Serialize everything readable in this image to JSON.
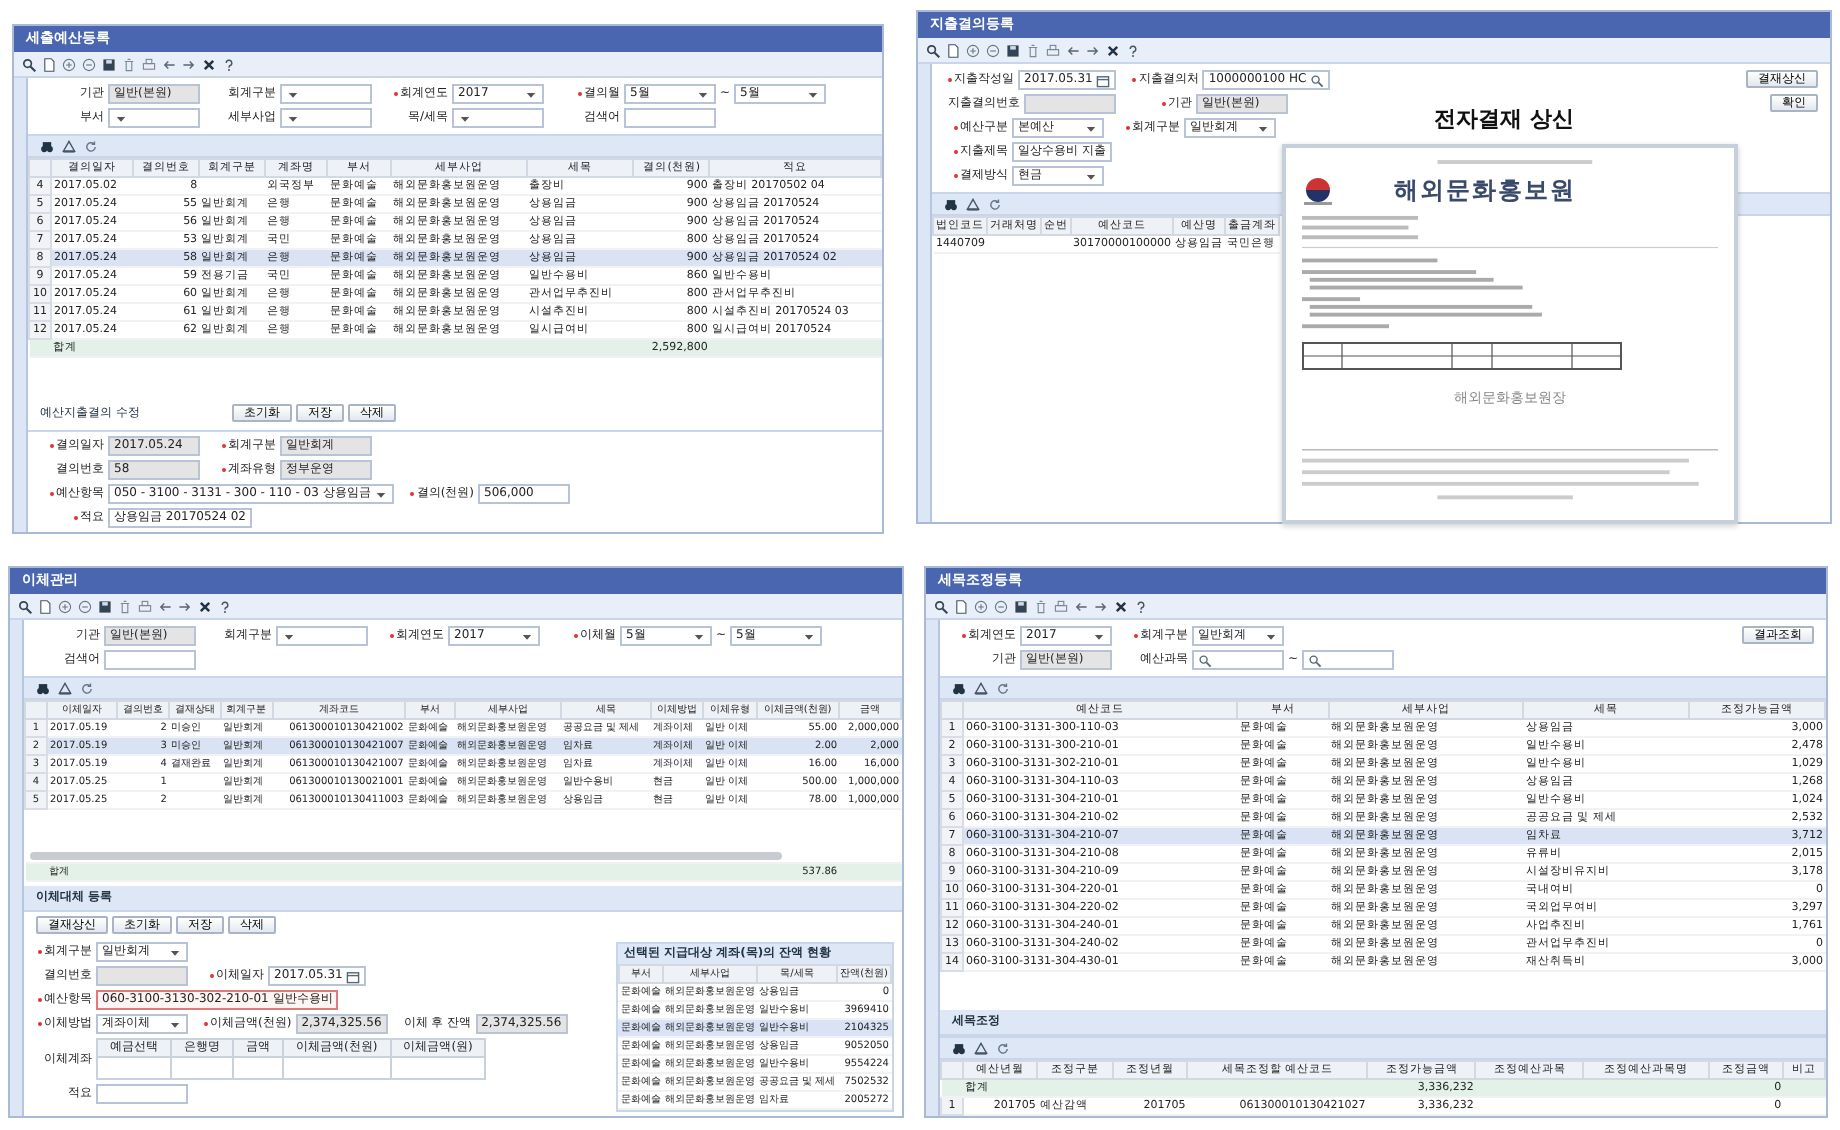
{
  "windows": [
    {
      "title": "세출예산등록",
      "form": {
        "rows": [
          [
            {
              "label": "기관",
              "value": "일반(본원)",
              "kind": "readonly",
              "required": false
            },
            {
              "label": "회계구분",
              "kind": "select",
              "required": false
            },
            {
              "label": "회계연도",
              "value": "2017",
              "kind": "select",
              "required": true
            },
            {
              "label": "결의월",
              "value": "5월",
              "kind": "select",
              "required": true,
              "separator": "~",
              "to": "5월"
            }
          ],
          [
            {
              "label": "부서",
              "kind": "select",
              "required": false
            },
            {
              "label": "세부사업",
              "kind": "select",
              "required": false
            },
            {
              "label": "목/세목",
              "kind": "select",
              "required": false
            },
            {
              "label": "검색어",
              "kind": "text",
              "required": false
            }
          ]
        ]
      },
      "grid": {
        "columns": [
          "결의일자",
          "결의번호",
          "회계구분",
          "계좌명",
          "부서",
          "세부사업",
          "세목",
          "결의(천원)",
          "적요"
        ],
        "rows": [
          {
            "no": "4",
            "cells": [
              "2017.05.02",
              "8",
              null,
              "외국정부",
              "문화예술",
              "해외문화홍보원운영",
              "출장비",
              "900",
              "출장비 20170502 04"
            ],
            "selected": false
          },
          {
            "no": "5",
            "cells": [
              "2017.05.24",
              "55",
              "일반회계",
              "은행",
              "문화예술",
              "해외문화홍보원운영",
              "상용임금",
              "900",
              "상용임금 20170524"
            ],
            "selected": false
          },
          {
            "no": "6",
            "cells": [
              "2017.05.24",
              "56",
              "일반회계",
              "은행",
              "문화예술",
              "해외문화홍보원운영",
              "상용임금",
              "900",
              "상용임금 20170524"
            ],
            "selected": false
          },
          {
            "no": "7",
            "cells": [
              "2017.05.24",
              "53",
              "일반회계",
              "국민",
              "문화예술",
              "해외문화홍보원운영",
              "상용임금",
              "800",
              "상용임금 20170524"
            ],
            "selected": false
          },
          {
            "no": "8",
            "cells": [
              "2017.05.24",
              "58",
              "일반회계",
              "은행",
              "문화예술",
              "해외문화홍보원운영",
              "상용임금",
              "900",
              "상용임금 20170524 02"
            ],
            "selected": true
          },
          {
            "no": "9",
            "cells": [
              "2017.05.24",
              "59",
              "전용기금",
              "국민",
              "문화예술",
              "해외문화홍보원운영",
              "일반수용비",
              "860",
              "일반수용비"
            ],
            "selected": false
          },
          {
            "no": "10",
            "cells": [
              "2017.05.24",
              "60",
              "일반회계",
              "은행",
              "문화예술",
              "해외문화홍보원운영",
              "관서업무추진비",
              "800",
              "관서업무추진비"
            ],
            "selected": false
          },
          {
            "no": "11",
            "cells": [
              "2017.05.24",
              "61",
              "일반회계",
              "은행",
              "문화예술",
              "해외문화홍보원운영",
              "시설추진비",
              "800",
              "시설추진비 20170524 03"
            ],
            "selected": false
          },
          {
            "no": "12",
            "cells": [
              "2017.05.24",
              "62",
              "일반회계",
              "은행",
              "문화예술",
              "해외문화홍보원운영",
              "일시급여비",
              "800",
              "일시급여비 20170524"
            ],
            "selected": false
          }
        ],
        "total": {
          "cells": [
            "합계",
            null,
            null,
            null,
            null,
            null,
            null,
            "2,592,800",
            null
          ]
        }
      },
      "section": {
        "title": "예산지출결의 수정",
        "buttons": [
          "초기화",
          "저장",
          "삭제"
        ],
        "form": {
          "rows": [
            [
              {
                "label": "결의일자",
                "value": "2017.05.24",
                "kind": "readonly",
                "required": true
              },
              {
                "label": "회계구분",
                "value": "일반회계",
                "kind": "readonly",
                "required": true
              }
            ],
            [
              {
                "label": "결의번호",
                "value": "58",
                "kind": "readonly",
                "required": false
              },
              {
                "label": "계좌유형",
                "value": "정부운영",
                "kind": "readonly",
                "required": true
              }
            ],
            [
              {
                "label": "예산항목",
                "value": "050 - 3100 - 3131 - 300 - 110 - 03 상용임금",
                "kind": "select",
                "required": true
              },
              {
                "label": "결의(천원)",
                "value": "506,000",
                "kind": "text",
                "required": true
              }
            ],
            [
              {
                "label": "적요",
                "value": "상용임금 20170524 02",
                "kind": "text",
                "required": true
              }
            ]
          ]
        }
      }
    },
    {
      "title": "지출결의등록",
      "form": {
        "rows": [
          [
            {
              "label": "지출작성일",
              "value": "2017.05.31",
              "kind": "date",
              "required": true
            },
            {
              "label": "지출결의처",
              "value": "1000000100 HC",
              "kind": "lookup",
              "required": true
            }
          ],
          [
            {
              "label": "지출결의번호",
              "kind": "readonly",
              "required": false
            },
            {
              "label": "기관",
              "value": "일반(본원)",
              "kind": "readonly",
              "required": true
            }
          ],
          [
            {
              "label": "예산구분",
              "value": "본예산",
              "kind": "select",
              "required": true
            },
            {
              "label": "회계구분",
              "value": "일반회계",
              "kind": "select",
              "required": true
            }
          ],
          [
            {
              "label": "지출제목",
              "value": "일상수용비 지출",
              "kind": "text",
              "required": true
            }
          ],
          [
            {
              "label": "결제방식",
              "value": "현금",
              "kind": "select",
              "required": true
            }
          ]
        ]
      },
      "side_buttons": [
        "결재상신",
        "확인"
      ],
      "grid": {
        "columns": [
          "법인코드",
          "거래처명",
          "순번",
          "예산코드",
          "예산명",
          "출금계좌"
        ],
        "rows": [
          {
            "cells": [
              "1440709",
              null,
              null,
              "30170000100000",
              "상용임금",
              "국민은행"
            ],
            "selected": false
          }
        ]
      },
      "overlay": {
        "heading": "전자결재 상신",
        "document": {
          "title": "해외문화홍보원",
          "footer": "해외문화홍보원장"
        }
      }
    },
    {
      "title": "이체관리",
      "form": {
        "rows": [
          [
            {
              "label": "기관",
              "value": "일반(본원)",
              "kind": "readonly",
              "required": false
            },
            {
              "label": "회계구분",
              "kind": "select",
              "required": false
            },
            {
              "label": "회계연도",
              "value": "2017",
              "kind": "select",
              "required": true
            },
            {
              "label": "이체월",
              "value": "5월",
              "kind": "select",
              "required": true,
              "separator": "~",
              "to": "5월"
            }
          ],
          [
            {
              "label": "검색어",
              "kind": "text",
              "required": false
            }
          ]
        ]
      },
      "grid": {
        "columns": [
          "이체일자",
          "결의번호",
          "결재상태",
          "회계구분",
          "계좌코드",
          "부서",
          "세부사업",
          "세목",
          "이체방법",
          "이체유형",
          "이체금액(천원)",
          "금액"
        ],
        "rows": [
          {
            "no": "1",
            "cells": [
              "2017.05.19",
              "2",
              "미승인",
              "일반회계",
              "061300010130421002",
              "문화예술",
              "해외문화홍보원운영",
              "공공요금 및 제세",
              "계좌이체",
              "일반 이체",
              "55.00",
              "2,000,000"
            ],
            "selected": false
          },
          {
            "no": "2",
            "cells": [
              "2017.05.19",
              "3",
              "미승인",
              "일반회계",
              "061300010130421007",
              "문화예술",
              "해외문화홍보원운영",
              "임차료",
              "계좌이체",
              "일반 이체",
              "2.00",
              "2,000"
            ],
            "selected": true
          },
          {
            "no": "3",
            "cells": [
              "2017.05.19",
              "4",
              "결재완료",
              "일반회계",
              "061300010130421007",
              "문화예술",
              "해외문화홍보원운영",
              "임차료",
              "계좌이체",
              "일반 이체",
              "16.00",
              "16,000"
            ],
            "selected": false
          },
          {
            "no": "4",
            "cells": [
              "2017.05.25",
              "1",
              null,
              "일반회계",
              "061300010130021001",
              "문화예술",
              "해외문화홍보원운영",
              "일반수용비",
              "현금",
              "일반 이체",
              "500.00",
              "1,000,000"
            ],
            "selected": false
          },
          {
            "no": "5",
            "cells": [
              "2017.05.25",
              "2",
              null,
              "일반회계",
              "061300010130411003",
              "문화예술",
              "해외문화홍보원운영",
              "상용임금",
              "현금",
              "일반 이체",
              "78.00",
              "1,000,000"
            ],
            "selected": false
          }
        ],
        "total": {
          "cells": [
            "합계",
            null,
            null,
            null,
            null,
            null,
            null,
            null,
            null,
            null,
            "537.86",
            null
          ]
        }
      },
      "section": {
        "title": "이체대체 등록",
        "buttons": [
          "결재상신",
          "초기화",
          "저장",
          "삭제"
        ],
        "form": {
          "rows": [
            [
              {
                "label": "회계구분",
                "value": "일반회계",
                "kind": "select",
                "required": true
              }
            ],
            [
              {
                "label": "결의번호",
                "kind": "readonly",
                "required": false
              },
              {
                "label": "이체일자",
                "value": "2017.05.31",
                "kind": "date",
                "required": true
              }
            ],
            [
              {
                "label": "예산항목",
                "value": "060-3100-3130-302-210-01 일반수용비",
                "kind": "text",
                "required": true,
                "invalid": true
              }
            ],
            [
              {
                "label": "이체방법",
                "value": "계좌이체",
                "kind": "select",
                "required": true
              },
              {
                "label": "이체금액(천원)",
                "value": "2,374,325.56",
                "kind": "readonly",
                "required": true
              },
              {
                "label": "이체 후 잔액",
                "value": "2,374,325.56",
                "kind": "readonly",
                "required": false
              }
            ],
            [
              {
                "label": "이체계좌",
                "kind": "table",
                "required": false,
                "columns": [
                  "예금선택",
                  "은행명",
                  "금액",
                  "이체금액(천원)",
                  "이체금액(원)"
                ]
              }
            ],
            [
              {
                "label": "적요",
                "kind": "text",
                "required": false
              }
            ]
          ]
        },
        "aside": {
          "title": "선택된 지급대상 계좌(목)의 잔액 현황",
          "grid": {
            "columns": [
              "부서",
              "세부사업",
              "목/세목",
              "잔액(천원)"
            ],
            "rows": [
              {
                "cells": [
                  "문화예술",
                  "해외문화홍보원운영",
                  "상용임금",
                  "0"
                ],
                "selected": false
              },
              {
                "cells": [
                  "문화예술",
                  "해외문화홍보원운영",
                  "일반수용비",
                  "3969410"
                ],
                "selected": false
              },
              {
                "cells": [
                  "문화예술",
                  "해외문화홍보원운영",
                  "일반수용비",
                  "2104325"
                ],
                "selected": true
              },
              {
                "cells": [
                  "문화예술",
                  "해외문화홍보원운영",
                  "상용임금",
                  "9052050"
                ],
                "selected": false
              },
              {
                "cells": [
                  "문화예술",
                  "해외문화홍보원운영",
                  "일반수용비",
                  "9554224"
                ],
                "selected": false
              },
              {
                "cells": [
                  "문화예술",
                  "해외문화홍보원운영",
                  "공공요금 및 제세",
                  "7502532"
                ],
                "selected": false
              },
              {
                "cells": [
                  "문화예술",
                  "해외문화홍보원운영",
                  "임차료",
                  "2005272"
                ],
                "selected": false
              }
            ]
          }
        }
      }
    },
    {
      "title": "세목조정등록",
      "form": {
        "rows": [
          [
            {
              "label": "회계연도",
              "value": "2017",
              "kind": "select",
              "required": true
            },
            {
              "label": "회계구분",
              "value": "일반회계",
              "kind": "select",
              "required": true
            }
          ],
          [
            {
              "label": "기관",
              "value": "일반(본원)",
              "kind": "readonly",
              "required": false
            },
            {
              "label": "예산과목",
              "kind": "lookup",
              "required": false,
              "separator": "~"
            }
          ]
        ]
      },
      "side_buttons": [
        "결과조회"
      ],
      "grid": {
        "columns": [
          "예산코드",
          "부서",
          "세부사업",
          "세목",
          "조정가능금액"
        ],
        "rows": [
          {
            "no": "1",
            "cells": [
              "060-3100-3131-300-110-03",
              "문화예술",
              "해외문화홍보원운영",
              "상용임금",
              "3,000"
            ],
            "selected": false
          },
          {
            "no": "2",
            "cells": [
              "060-3100-3131-300-210-01",
              "문화예술",
              "해외문화홍보원운영",
              "일반수용비",
              "2,478"
            ],
            "selected": false
          },
          {
            "no": "3",
            "cells": [
              "060-3100-3131-302-210-01",
              "문화예술",
              "해외문화홍보원운영",
              "일반수용비",
              "1,029"
            ],
            "selected": false
          },
          {
            "no": "4",
            "cells": [
              "060-3100-3131-304-110-03",
              "문화예술",
              "해외문화홍보원운영",
              "상용임금",
              "1,268"
            ],
            "selected": false
          },
          {
            "no": "5",
            "cells": [
              "060-3100-3131-304-210-01",
              "문화예술",
              "해외문화홍보원운영",
              "일반수용비",
              "1,024"
            ],
            "selected": false
          },
          {
            "no": "6",
            "cells": [
              "060-3100-3131-304-210-02",
              "문화예술",
              "해외문화홍보원운영",
              "공공요금 및 제세",
              "2,532"
            ],
            "selected": false
          },
          {
            "no": "7",
            "cells": [
              "060-3100-3131-304-210-07",
              "문화예술",
              "해외문화홍보원운영",
              "임차료",
              "3,712"
            ],
            "selected": true
          },
          {
            "no": "8",
            "cells": [
              "060-3100-3131-304-210-08",
              "문화예술",
              "해외문화홍보원운영",
              "유류비",
              "2,015"
            ],
            "selected": false
          },
          {
            "no": "9",
            "cells": [
              "060-3100-3131-304-210-09",
              "문화예술",
              "해외문화홍보원운영",
              "시설장비유지비",
              "3,178"
            ],
            "selected": false
          },
          {
            "no": "10",
            "cells": [
              "060-3100-3131-304-220-01",
              "문화예술",
              "해외문화홍보원운영",
              "국내여비",
              "0"
            ],
            "selected": false
          },
          {
            "no": "11",
            "cells": [
              "060-3100-3131-304-220-02",
              "문화예술",
              "해외문화홍보원운영",
              "국외업무여비",
              "3,297"
            ],
            "selected": false
          },
          {
            "no": "12",
            "cells": [
              "060-3100-3131-304-240-01",
              "문화예술",
              "해외문화홍보원운영",
              "사업추진비",
              "1,761"
            ],
            "selected": false
          },
          {
            "no": "13",
            "cells": [
              "060-3100-3131-304-240-02",
              "문화예술",
              "해외문화홍보원운영",
              "관서업무추진비",
              "0"
            ],
            "selected": false
          },
          {
            "no": "14",
            "cells": [
              "060-3100-3131-304-430-01",
              "문화예술",
              "해외문화홍보원운영",
              "재산취득비",
              "3,000"
            ],
            "selected": false
          }
        ]
      },
      "section": {
        "title": "세목조정",
        "grid": {
          "columns": [
            "예산년월",
            "조정구분",
            "조정년월",
            "세목조정할 예산코드",
            "조정가능금액",
            "조정예산과목",
            "조정예산과목명",
            "조정금액",
            "비고"
          ],
          "total_first": true,
          "rows": [
            {
              "no": "1",
              "cells": [
                "201705",
                "예산감액",
                "201705",
                "061300010130421027",
                "3,336,232",
                null,
                null,
                "0",
                null
              ],
              "selected": false
            }
          ],
          "total": {
            "cells": [
              "합계",
              null,
              null,
              null,
              "3,336,232",
              null,
              null,
              "0",
              null
            ]
          }
        }
      }
    }
  ]
}
